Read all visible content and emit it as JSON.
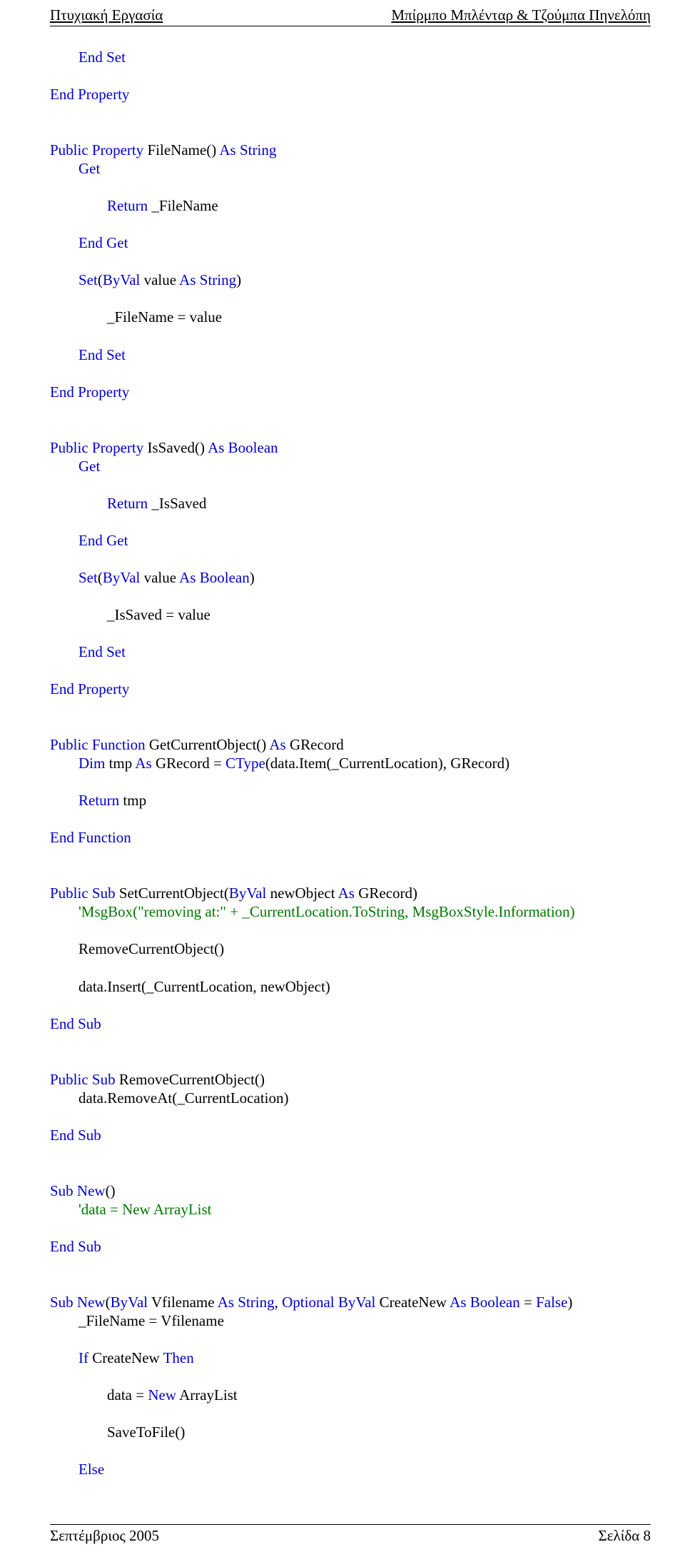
{
  "header": {
    "left": "Πτυχιακή Εργασία",
    "right": "Μπίρμπο Μπλένταρ & Τζούμπα Πηνελόπη"
  },
  "code": {
    "l1": "End Set",
    "l2": "End Property",
    "l3": "Public Property",
    "l3b": " FileName() ",
    "l3c": "As String",
    "l4": "Get",
    "l5a": "Return",
    "l5b": " _FileName",
    "l6": "End Get",
    "l7a": "Set",
    "l7b": "(",
    "l7c": "ByVal",
    "l7d": " value ",
    "l7e": "As String",
    "l7f": ")",
    "l8": "_FileName = value",
    "l9": "End Set",
    "l10": "End Property",
    "l11a": "Public Property",
    "l11b": " IsSaved() ",
    "l11c": "As Boolean",
    "l12": "Get",
    "l13a": "Return",
    "l13b": " _IsSaved",
    "l14": "End Get",
    "l15a": "Set",
    "l15b": "(",
    "l15c": "ByVal",
    "l15d": " value ",
    "l15e": "As Boolean",
    "l15f": ")",
    "l16": "_IsSaved = value",
    "l17": "End Set",
    "l18": "End Property",
    "l19a": "Public Function",
    "l19b": " GetCurrentObject() ",
    "l19c": "As",
    "l19d": " GRecord",
    "l20a": "Dim",
    "l20b": " tmp ",
    "l20c": "As",
    "l20d": " GRecord = ",
    "l20e": "CType",
    "l20f": "(data.Item(_CurrentLocation), GRecord)",
    "l21a": "Return",
    "l21b": " tmp",
    "l22": "End Function",
    "l23a": "Public Sub",
    "l23b": " SetCurrentObject(",
    "l23c": "ByVal",
    "l23d": " newObject ",
    "l23e": "As",
    "l23f": " GRecord)",
    "l24": "'MsgBox(\"removing at:\" + _CurrentLocation.ToString, MsgBoxStyle.Information)",
    "l25": "RemoveCurrentObject()",
    "l26": "data.Insert(_CurrentLocation, newObject)",
    "l27": "End Sub",
    "l28a": "Public Sub",
    "l28b": " RemoveCurrentObject()",
    "l29": "data.RemoveAt(_CurrentLocation)",
    "l30": "End Sub",
    "l31a": "Sub New",
    "l31b": "()",
    "l32": "'data = New ArrayList",
    "l33": "End Sub",
    "l34a": "Sub New",
    "l34b": "(",
    "l34c": "ByVal",
    "l34d": " Vfilename ",
    "l34e": "As String",
    "l34f": ", ",
    "l34g": "Optional ByVal",
    "l34h": " CreateNew ",
    "l34i": "As Boolean",
    "l34j": " = ",
    "l34k": "False",
    "l34l": ")",
    "l35": "_FileName = Vfilename",
    "l36a": "If",
    "l36b": " CreateNew ",
    "l36c": "Then",
    "l37a": "data = ",
    "l37b": "New",
    "l37c": " ArrayList",
    "l38": "SaveToFile()",
    "l39": "Else"
  },
  "footer": {
    "left": "Σεπτέμβριος 2005",
    "right": "Σελίδα 8"
  }
}
